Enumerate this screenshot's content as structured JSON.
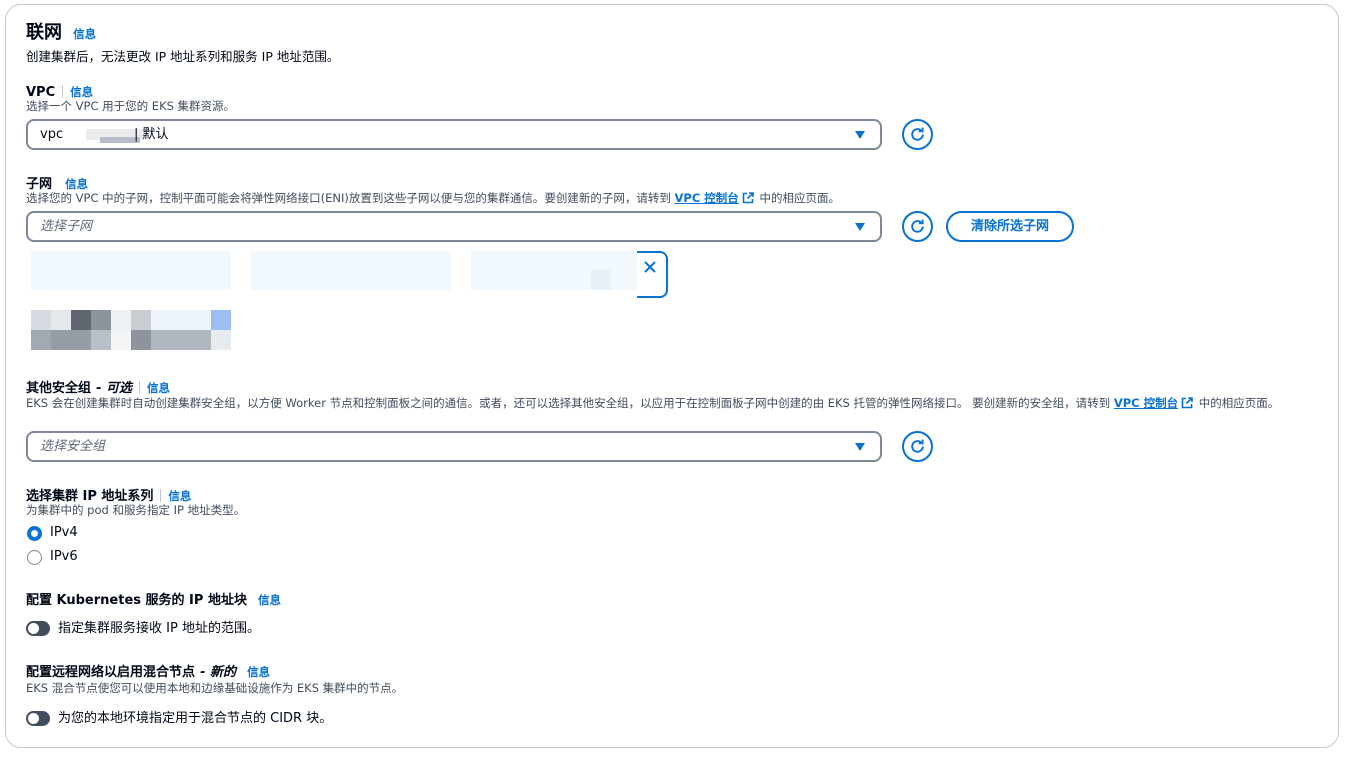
{
  "section": {
    "title": "联网",
    "info": "信息",
    "description": "创建集群后，无法更改 IP 地址系列和服务 IP 地址范围。"
  },
  "vpc": {
    "label": "VPC",
    "info": "信息",
    "description": "选择一个 VPC 用于您的 EKS 集群资源。",
    "value_prefix": "vpc",
    "value_suffix": "| 默认"
  },
  "subnet": {
    "label": "子网",
    "info": "信息",
    "description_before": "选择您的 VPC 中的子网，控制平面可能会将弹性网络接口(ENI)放置到这些子网以便与您的集群通信。要创建新的子网，请转到",
    "link": "VPC 控制台",
    "description_after": "中的相应页面。",
    "placeholder": "选择子网",
    "clear_button": "清除所选子网"
  },
  "security_group": {
    "label": "其他安全组",
    "optional": "- 可选",
    "info": "信息",
    "description_before": "EKS 会在创建集群时自动创建集群安全组，以方便 Worker 节点和控制面板之间的通信。或者，还可以选择其他安全组，以应用于在控制面板子网中创建的由 EKS 托管的弹性网络接口。 要创建新的安全组，请转到",
    "link": "VPC 控制台",
    "description_after": "中的相应页面。",
    "placeholder": "选择安全组"
  },
  "ip_family": {
    "label": "选择集群 IP 地址系列",
    "info": "信息",
    "description": "为集群中的 pod 和服务指定 IP 地址类型。",
    "options": [
      "IPv4",
      "IPv6"
    ],
    "selected": "IPv4"
  },
  "k8s_service": {
    "label": "配置 Kubernetes 服务的 IP 地址块",
    "info": "信息",
    "toggle_label": "指定集群服务接收 IP 地址的范围。",
    "enabled": false
  },
  "hybrid": {
    "label": "配置远程网络以启用混合节点",
    "badge": "- 新的",
    "info": "信息",
    "description": "EKS 混合节点使您可以使用本地和边缘基础设施作为 EKS 集群中的节点。",
    "toggle_label": "为您的本地环境指定用于混合节点的 CIDR 块。",
    "enabled": false
  },
  "icons": [
    "refresh-icon",
    "caret-down-icon",
    "close-icon",
    "external-link-icon"
  ],
  "colors": {
    "accent": "#0972d3",
    "border": "#7d8998",
    "text": "#000716",
    "muted": "#414d5c"
  }
}
